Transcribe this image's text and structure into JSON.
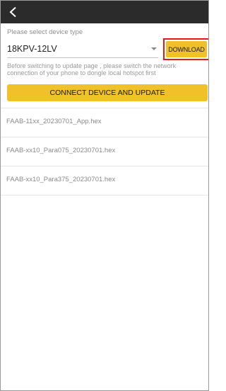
{
  "header": {
    "back_icon": "chevron-left-icon"
  },
  "device_type": {
    "label": "Please select device type",
    "selected_value": "18KPV-12LV",
    "download_label": "DOWNLOAD"
  },
  "notice": {
    "text": "Before switching to update page , please switch the network connection of your phone to dongle local hotspot first"
  },
  "connect_button": {
    "label": "CONNECT DEVICE AND UPDATE"
  },
  "files": [
    {
      "name": "FAAB-11xx_20230701_App.hex"
    },
    {
      "name": "FAAB-xx10_Para075_20230701.hex"
    },
    {
      "name": "FAAB-xx10_Para375_20230701.hex"
    }
  ],
  "colors": {
    "app_bar": "#2b2b2b",
    "accent_yellow": "#f1c12a",
    "highlight_red": "#e01a1a"
  }
}
